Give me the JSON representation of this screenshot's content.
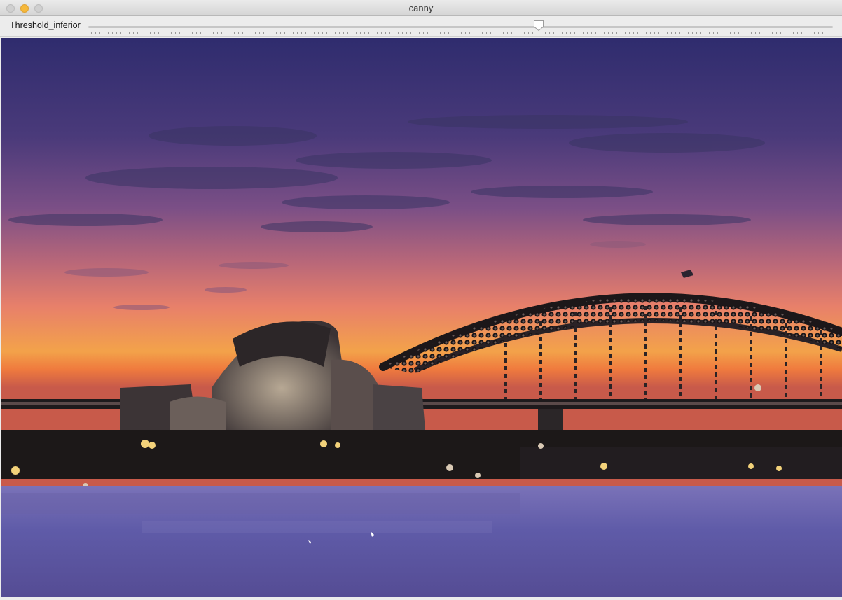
{
  "window": {
    "title": "canny"
  },
  "trackbar": {
    "label": "Threshold_inferior",
    "value_fraction": 0.605
  },
  "image": {
    "subject": "stylized-harbour-sunset",
    "colors": {
      "sky_top": "#2f2c6e",
      "sky_mid": "#7b4f86",
      "sky_low": "#e8806a",
      "horizon": "#f3a24a",
      "water": "#5f5ba8",
      "silhouette": "#1a1618"
    }
  }
}
